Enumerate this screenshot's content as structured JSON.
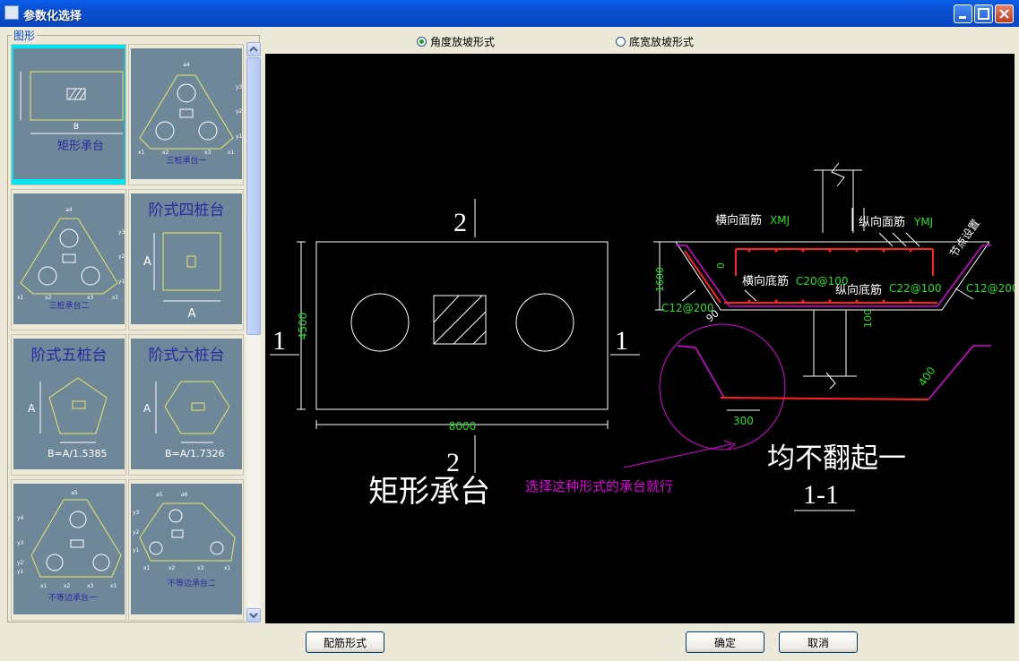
{
  "window": {
    "title": "参数化选择"
  },
  "left": {
    "group_label": "图形",
    "thumbs": [
      {
        "label": "矩形承台",
        "dims": [
          "B"
        ]
      },
      {
        "label": "三桩承台一",
        "dims": [
          "a4",
          "y3",
          "y2",
          "y1",
          "x1",
          "x2",
          "x3",
          "x1"
        ]
      },
      {
        "label": "三桩承台二",
        "dims": [
          "a4",
          "y3",
          "y2",
          "y1",
          "x1",
          "x2",
          "x3",
          "x1"
        ]
      },
      {
        "label": "阶式四桩台",
        "dims": [
          "A",
          "A"
        ]
      },
      {
        "label": "阶式五桩台",
        "dims": [
          "A",
          "B=A/1.5385"
        ]
      },
      {
        "label": "阶式六桩台",
        "dims": [
          "A",
          "B=A/1.7326"
        ]
      },
      {
        "label": "不等边承台一",
        "dims": [
          "a5",
          "y4",
          "y3",
          "y2",
          "y1",
          "x1",
          "x2",
          "x3",
          "x1"
        ]
      },
      {
        "label": "不等边承台二",
        "dims": [
          "a5",
          "a6",
          "y3",
          "y2",
          "y1",
          "x1",
          "x2",
          "x3",
          "x1"
        ]
      }
    ]
  },
  "options": {
    "radio1": "角度放坡形式",
    "radio2": "底宽放坡形式",
    "selected": "radio1"
  },
  "drawing": {
    "plan": {
      "section_mark_top": "2",
      "section_mark_bottom": "2",
      "section_mark_left": "1",
      "section_mark_right": "1",
      "width_dim": "8000",
      "height_dim": "4500",
      "title": "矩形承台",
      "note": "选择这种形式的承台就行"
    },
    "section": {
      "top_bar_label": "横向面筋",
      "top_bar_code": "XMJ",
      "long_top_label": "纵向面筋",
      "long_top_code": "YMJ",
      "slope_label": "节点设置",
      "bottom_bar_label": "横向底筋",
      "bottom_bar_code": "C20@100",
      "long_bottom_label": "纵向底筋",
      "long_bottom_code": "C22@100",
      "side_left": "C12@200",
      "side_right": "C12@200",
      "height_dim": "1600",
      "zero": "0",
      "angle": "90",
      "bottom_dim": "100",
      "detail_300": "300",
      "detail_400": "400",
      "annotation": "均不翻起一",
      "title": "1-1"
    },
    "colors": {
      "rebar": "#ff2020",
      "slope": "#e000e0",
      "dim": "#20e020",
      "line": "#ffffff"
    }
  },
  "buttons": {
    "rebar_form": "配筋形式",
    "ok": "确定",
    "cancel": "取消"
  }
}
